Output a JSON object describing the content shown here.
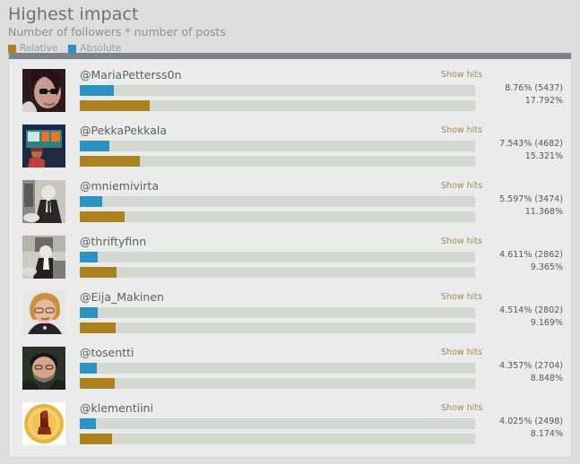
{
  "header": {
    "title": "Highest impact",
    "subtitle": "Number of followers * number of posts",
    "legend": [
      {
        "label": "Relative",
        "color": "#ac8220",
        "key": "relative"
      },
      {
        "label": "Absolute",
        "color": "#2a93c4",
        "key": "absolute"
      }
    ]
  },
  "common": {
    "show_hits_label": "Show hits"
  },
  "colors": {
    "relative_bar": "#ac8220",
    "absolute_bar": "#2a93c4",
    "bar_track": "#d5d8d0",
    "panel_bg": "#ebebeb",
    "panel_topbar": "#7c838b",
    "page_bg": "#dddddd",
    "link": "#a08a54"
  },
  "chart_data": {
    "type": "bar",
    "title": "Highest impact",
    "subtitle": "Number of followers * number of posts",
    "xlabel": "",
    "ylabel": "",
    "series": [
      {
        "name": "Absolute",
        "color": "#2a93c4",
        "values": [
          8.76,
          7.543,
          5.597,
          4.611,
          4.514,
          4.357,
          4.025
        ]
      },
      {
        "name": "Relative",
        "color": "#ac8220",
        "values": [
          17.792,
          15.321,
          11.368,
          9.365,
          9.169,
          8.848,
          8.174
        ]
      }
    ],
    "categories": [
      "@MariaPetterss0n",
      "@PekkaPekkala",
      "@mniemivirta",
      "@thriftyfinn",
      "@Eija_Makinen",
      "@tosentti",
      "@klementiini"
    ],
    "absolute_counts": [
      5437,
      4682,
      3474,
      2862,
      2802,
      2704,
      2498
    ],
    "legend_position": "top-left",
    "grid": false
  },
  "rows": [
    {
      "username": "@MariaPetterss0n",
      "show_hits": "Show hits",
      "absolute_text": "8.76% (5437)",
      "relative_text": "17.792%",
      "absolute_pct": 8.76,
      "relative_pct": 17.792,
      "absolute_width": 38,
      "relative_width": 78,
      "avatar": "maria-avatar"
    },
    {
      "username": "@PekkaPekkala",
      "show_hits": "Show hits",
      "absolute_text": "7.543% (4682)",
      "relative_text": "15.321%",
      "absolute_pct": 7.543,
      "relative_pct": 15.321,
      "absolute_width": 33,
      "relative_width": 67,
      "avatar": "pekka-avatar"
    },
    {
      "username": "@mniemivirta",
      "show_hits": "Show hits",
      "absolute_text": "5.597% (3474)",
      "relative_text": "11.368%",
      "absolute_pct": 5.597,
      "relative_pct": 11.368,
      "absolute_width": 25,
      "relative_width": 50,
      "avatar": "mniemi-avatar"
    },
    {
      "username": "@thriftyfinn",
      "show_hits": "Show hits",
      "absolute_text": "4.611% (2862)",
      "relative_text": "9.365%",
      "absolute_pct": 4.611,
      "relative_pct": 9.365,
      "absolute_width": 20,
      "relative_width": 41,
      "avatar": "thrifty-avatar"
    },
    {
      "username": "@Eija_Makinen",
      "show_hits": "Show hits",
      "absolute_text": "4.514% (2802)",
      "relative_text": "9.169%",
      "absolute_pct": 4.514,
      "relative_pct": 9.169,
      "absolute_width": 20,
      "relative_width": 40,
      "avatar": "eija-avatar"
    },
    {
      "username": "@tosentti",
      "show_hits": "Show hits",
      "absolute_text": "4.357% (2704)",
      "relative_text": "8.848%",
      "absolute_pct": 4.357,
      "relative_pct": 8.848,
      "absolute_width": 19,
      "relative_width": 39,
      "avatar": "tosentti-avatar"
    },
    {
      "username": "@klementiini",
      "show_hits": "Show hits",
      "absolute_text": "4.025% (2498)",
      "relative_text": "8.174%",
      "absolute_pct": 4.025,
      "relative_pct": 8.174,
      "absolute_width": 18,
      "relative_width": 36,
      "avatar": "klementiini-avatar"
    }
  ]
}
